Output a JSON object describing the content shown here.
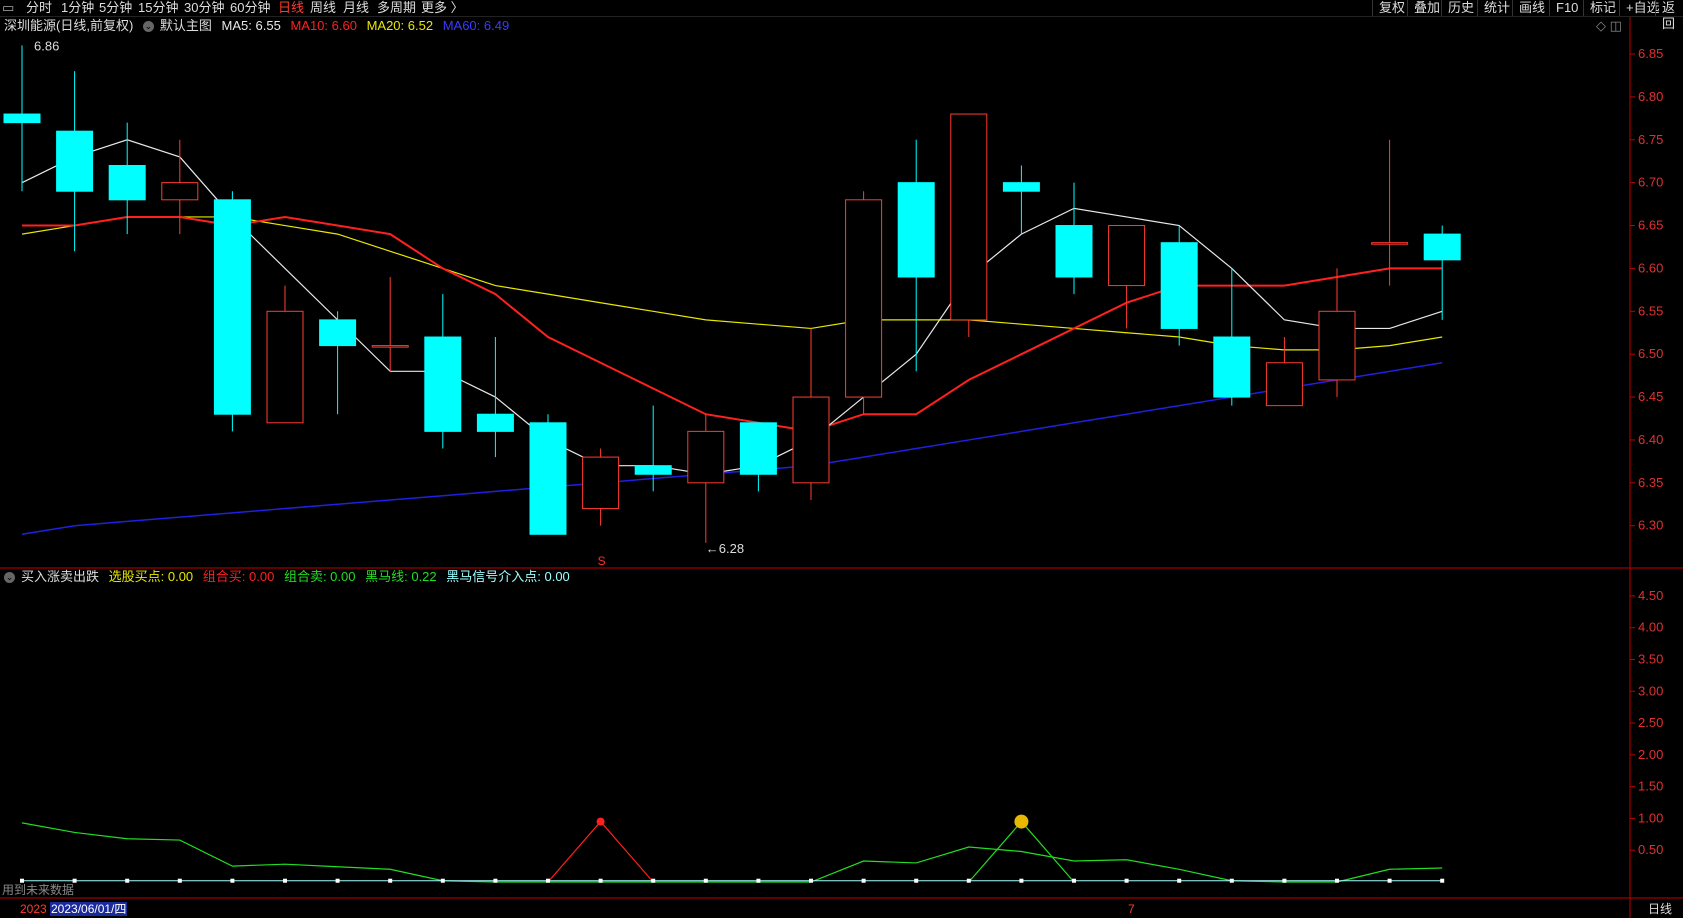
{
  "toolbar": {
    "periods": [
      "分时",
      "1分钟",
      "5分钟",
      "15分钟",
      "30分钟",
      "60分钟",
      "日线",
      "周线",
      "月线",
      "多周期",
      "更多 〉"
    ],
    "active_period": "日线",
    "tools": [
      "复权",
      "叠加",
      "历史",
      "统计",
      "画线",
      "F10",
      "标记",
      "+自选",
      "返回"
    ]
  },
  "main_legend": {
    "stock": "深圳能源(日线,前复权)",
    "template": "默认主图",
    "ma5": "MA5: 6.55",
    "ma10": "MA10: 6.60",
    "ma20": "MA20: 6.52",
    "ma60": "MA60: 6.49"
  },
  "sub_legend": {
    "name": "买入涨卖出跌",
    "buy_point": "选股买点: 0.00",
    "combo_buy": "组合买: 0.00",
    "combo_sell": "组合卖: 0.00",
    "darkhorse_line": "黑马线: 0.22",
    "darkhorse_signal": "黑马信号介入点: 0.00"
  },
  "annotations": {
    "high": "6.86",
    "low": "←6.28",
    "signal_s": "S",
    "bottom_note": "用到未来数据"
  },
  "bottom_axis": {
    "year": "2023",
    "cursor_date": "2023/06/01/四",
    "month_mark": "7",
    "period_label": "日线"
  },
  "colors": {
    "up": "#ff3b30",
    "down": "#00ffff",
    "ma5": "#e8e8e8",
    "ma10": "#ff2020",
    "ma20": "#e8e800",
    "ma60": "#2020e0",
    "axis": "#c00000"
  },
  "chart_data": [
    {
      "type": "candlestick",
      "yticks": [
        6.3,
        6.35,
        6.4,
        6.45,
        6.5,
        6.55,
        6.6,
        6.65,
        6.7,
        6.75,
        6.8,
        6.85
      ],
      "ylim": [
        6.27,
        6.87
      ],
      "candles": [
        {
          "o": 6.78,
          "h": 6.86,
          "l": 6.69,
          "c": 6.77
        },
        {
          "o": 6.76,
          "h": 6.83,
          "l": 6.62,
          "c": 6.69
        },
        {
          "o": 6.72,
          "h": 6.77,
          "l": 6.64,
          "c": 6.68
        },
        {
          "o": 6.68,
          "h": 6.75,
          "l": 6.64,
          "c": 6.7
        },
        {
          "o": 6.68,
          "h": 6.69,
          "l": 6.41,
          "c": 6.43
        },
        {
          "o": 6.42,
          "h": 6.58,
          "l": 6.42,
          "c": 6.55
        },
        {
          "o": 6.54,
          "h": 6.55,
          "l": 6.43,
          "c": 6.51
        },
        {
          "o": 6.51,
          "h": 6.59,
          "l": 6.48,
          "c": 6.51
        },
        {
          "o": 6.52,
          "h": 6.57,
          "l": 6.39,
          "c": 6.41
        },
        {
          "o": 6.43,
          "h": 6.52,
          "l": 6.38,
          "c": 6.41
        },
        {
          "o": 6.42,
          "h": 6.43,
          "l": 6.29,
          "c": 6.29
        },
        {
          "o": 6.32,
          "h": 6.39,
          "l": 6.3,
          "c": 6.38
        },
        {
          "o": 6.37,
          "h": 6.44,
          "l": 6.34,
          "c": 6.36
        },
        {
          "o": 6.35,
          "h": 6.43,
          "l": 6.28,
          "c": 6.41
        },
        {
          "o": 6.42,
          "h": 6.42,
          "l": 6.34,
          "c": 6.36
        },
        {
          "o": 6.35,
          "h": 6.53,
          "l": 6.33,
          "c": 6.45
        },
        {
          "o": 6.45,
          "h": 6.69,
          "l": 6.43,
          "c": 6.68
        },
        {
          "o": 6.7,
          "h": 6.75,
          "l": 6.48,
          "c": 6.59
        },
        {
          "o": 6.54,
          "h": 6.78,
          "l": 6.52,
          "c": 6.78
        },
        {
          "o": 6.7,
          "h": 6.72,
          "l": 6.64,
          "c": 6.69
        },
        {
          "o": 6.65,
          "h": 6.7,
          "l": 6.57,
          "c": 6.59
        },
        {
          "o": 6.58,
          "h": 6.65,
          "l": 6.53,
          "c": 6.65
        },
        {
          "o": 6.63,
          "h": 6.65,
          "l": 6.51,
          "c": 6.53
        },
        {
          "o": 6.52,
          "h": 6.6,
          "l": 6.44,
          "c": 6.45
        },
        {
          "o": 6.44,
          "h": 6.52,
          "l": 6.44,
          "c": 6.49
        },
        {
          "o": 6.47,
          "h": 6.6,
          "l": 6.45,
          "c": 6.55
        },
        {
          "o": 6.63,
          "h": 6.75,
          "l": 6.58,
          "c": 6.63
        },
        {
          "o": 6.64,
          "h": 6.65,
          "l": 6.54,
          "c": 6.61
        }
      ],
      "ma5": [
        6.7,
        6.73,
        6.75,
        6.73,
        6.66,
        6.6,
        6.54,
        6.48,
        6.48,
        6.45,
        6.4,
        6.37,
        6.37,
        6.36,
        6.37,
        6.4,
        6.45,
        6.5,
        6.59,
        6.64,
        6.67,
        6.66,
        6.65,
        6.6,
        6.54,
        6.53,
        6.53,
        6.55
      ],
      "ma10": [
        6.65,
        6.65,
        6.66,
        6.66,
        6.65,
        6.66,
        6.65,
        6.64,
        6.6,
        6.57,
        6.52,
        6.49,
        6.46,
        6.43,
        6.42,
        6.41,
        6.43,
        6.43,
        6.47,
        6.5,
        6.53,
        6.56,
        6.58,
        6.58,
        6.58,
        6.59,
        6.6,
        6.6
      ],
      "ma20": [
        6.64,
        6.65,
        6.66,
        6.66,
        6.66,
        6.65,
        6.64,
        6.62,
        6.6,
        6.58,
        6.57,
        6.56,
        6.55,
        6.54,
        6.535,
        6.53,
        6.54,
        6.54,
        6.54,
        6.535,
        6.53,
        6.525,
        6.52,
        6.51,
        6.505,
        6.505,
        6.51,
        6.52
      ],
      "ma60": [
        6.29,
        6.3,
        6.305,
        6.31,
        6.315,
        6.32,
        6.325,
        6.33,
        6.335,
        6.34,
        6.345,
        6.35,
        6.355,
        6.36,
        6.365,
        6.37,
        6.38,
        6.39,
        6.4,
        6.41,
        6.42,
        6.43,
        6.44,
        6.45,
        6.46,
        6.47,
        6.48,
        6.49
      ]
    },
    {
      "type": "line",
      "yticks": [
        0.5,
        1.0,
        1.5,
        2.0,
        2.5,
        3.0,
        3.5,
        4.0,
        4.5
      ],
      "ylim": [
        0,
        4.75
      ],
      "darkhorse_line": [
        0.93,
        0.78,
        0.68,
        0.66,
        0.25,
        0.28,
        0.24,
        0.2,
        0.02,
        0,
        0,
        0,
        0,
        0,
        0,
        0,
        0.33,
        0.3,
        0.55,
        0.48,
        0.33,
        0.35,
        0.2,
        0.02,
        0,
        0,
        0.2,
        0.22
      ],
      "buy_signal": {
        "index": 11,
        "value": 0.95
      },
      "sell_signal": {
        "index": 19,
        "value": 0.95
      },
      "flat_markers": 0.02
    }
  ]
}
